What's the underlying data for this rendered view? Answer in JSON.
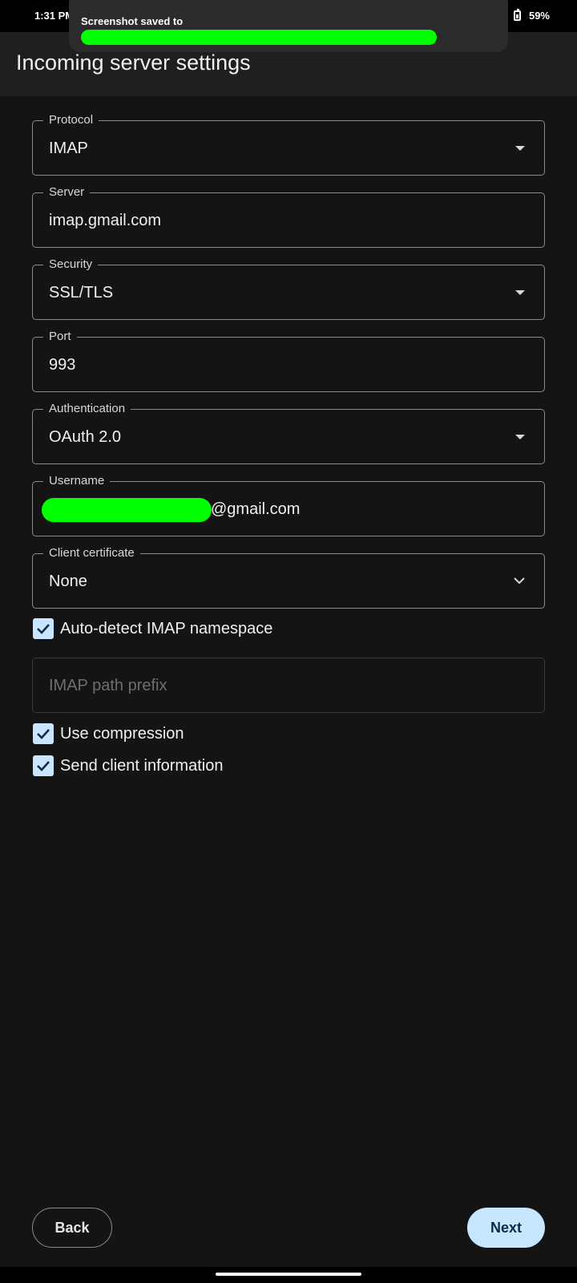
{
  "status_bar": {
    "time": "1:31 PM",
    "battery": "59%"
  },
  "toast": {
    "text": "Screenshot saved to"
  },
  "app_bar": {
    "title": "Incoming server settings"
  },
  "form": {
    "protocol": {
      "label": "Protocol",
      "value": "IMAP"
    },
    "server": {
      "label": "Server",
      "value": "imap.gmail.com"
    },
    "security": {
      "label": "Security",
      "value": "SSL/TLS"
    },
    "port": {
      "label": "Port",
      "value": "993"
    },
    "authentication": {
      "label": "Authentication",
      "value": "OAuth 2.0"
    },
    "username": {
      "label": "Username",
      "value_suffix": "@gmail.com"
    },
    "client_certificate": {
      "label": "Client certificate",
      "value": "None"
    },
    "auto_detect_namespace": {
      "label": "Auto-detect IMAP namespace",
      "checked": true
    },
    "imap_path_prefix": {
      "placeholder": "IMAP path prefix"
    },
    "use_compression": {
      "label": "Use compression",
      "checked": true
    },
    "send_client_info": {
      "label": "Send client information",
      "checked": true
    }
  },
  "buttons": {
    "back": "Back",
    "next": "Next"
  },
  "colors": {
    "accent": "#c6e7ff",
    "background": "#141414",
    "redaction": "#00ff00"
  }
}
